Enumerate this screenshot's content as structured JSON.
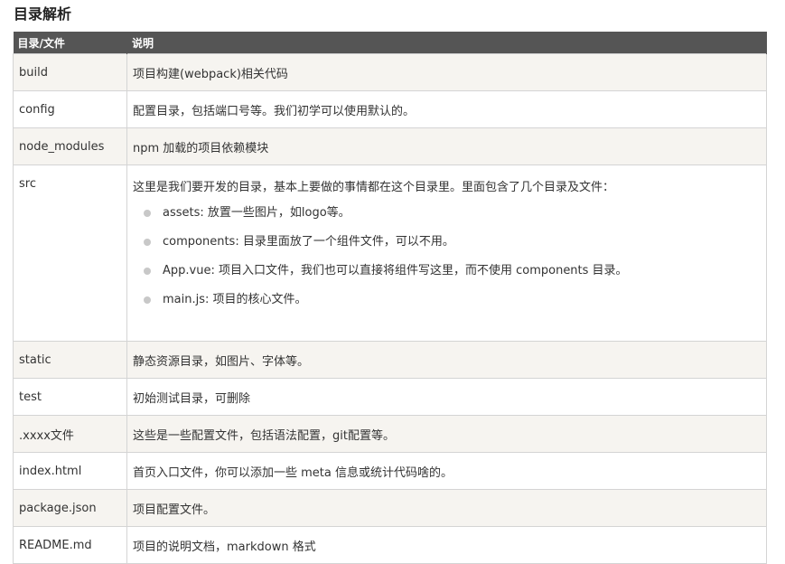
{
  "title": "目录解析",
  "table": {
    "headers": [
      "目录/文件",
      "说明"
    ],
    "rows": [
      {
        "name": "build",
        "desc": "项目构建(webpack)相关代码"
      },
      {
        "name": "config",
        "desc": "配置目录，包括端口号等。我们初学可以使用默认的。"
      },
      {
        "name": "node_modules",
        "desc": "npm 加载的项目依赖模块"
      },
      {
        "name": "src",
        "desc": "这里是我们要开发的目录，基本上要做的事情都在这个目录里。里面包含了几个目录及文件："
      },
      {
        "name": "static",
        "desc": "静态资源目录，如图片、字体等。"
      },
      {
        "name": "test",
        "desc": "初始测试目录，可删除"
      },
      {
        "name": ".xxxx文件",
        "desc": "这些是一些配置文件，包括语法配置，git配置等。"
      },
      {
        "name": "index.html",
        "desc": "首页入口文件，你可以添加一些 meta 信息或统计代码啥的。"
      },
      {
        "name": "package.json",
        "desc": "项目配置文件。"
      },
      {
        "name": "README.md",
        "desc": "项目的说明文档，markdown 格式"
      }
    ],
    "src_items": [
      "assets: 放置一些图片，如logo等。",
      "components: 目录里面放了一个组件文件，可以不用。",
      "App.vue: 项目入口文件，我们也可以直接将组件写这里，而不使用 components 目录。",
      "main.js: 项目的核心文件。"
    ]
  }
}
